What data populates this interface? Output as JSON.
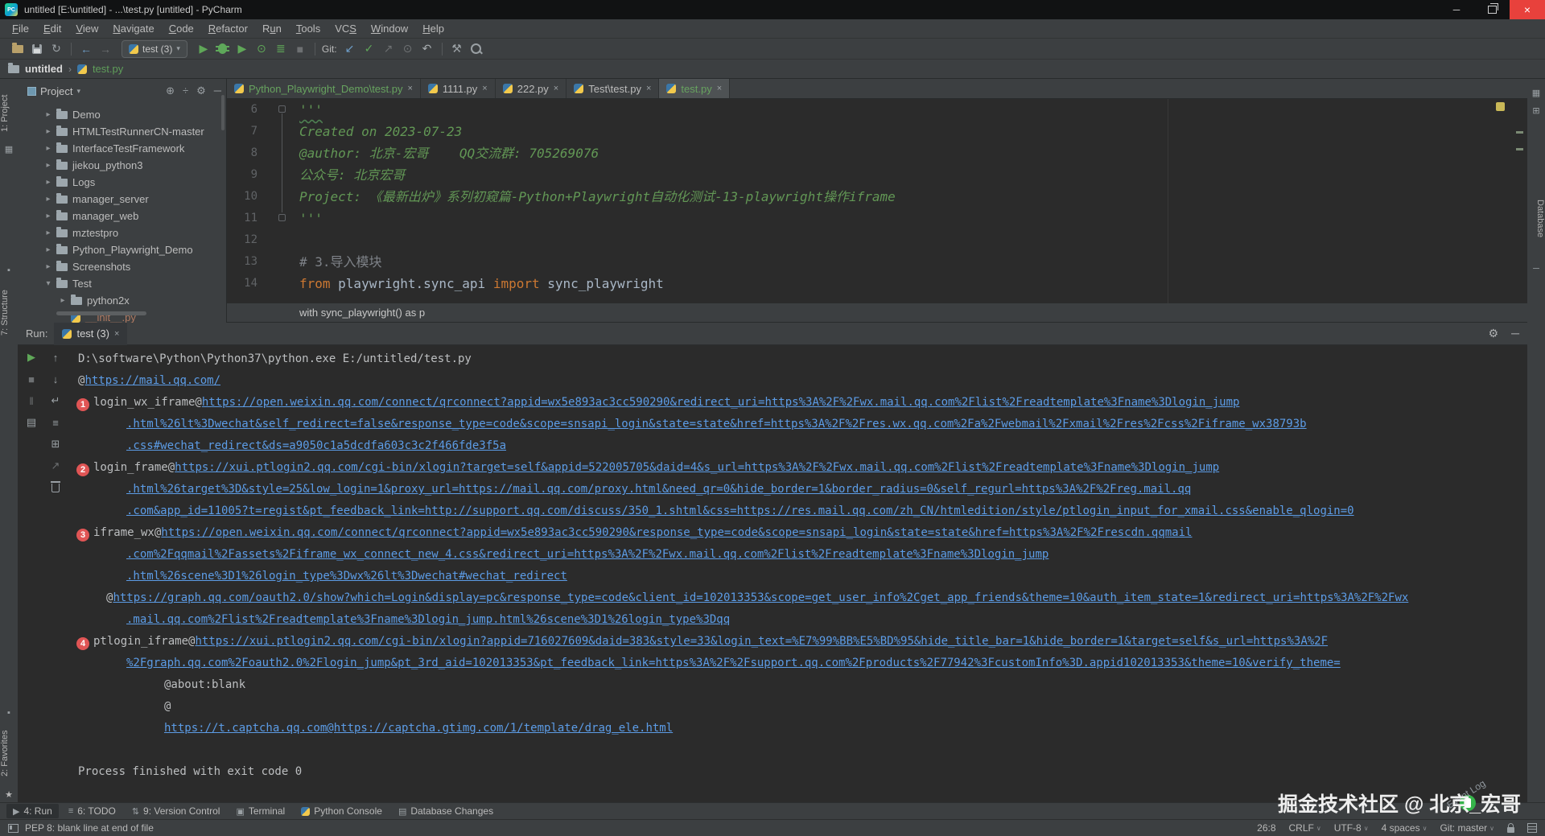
{
  "window": {
    "title": "untitled [E:\\untitled] - ...\\test.py [untitled] - PyCharm",
    "logo": "PC",
    "minimize": "─",
    "close": "×"
  },
  "menus": [
    {
      "label": "File",
      "m": 0
    },
    {
      "label": "Edit",
      "m": 0
    },
    {
      "label": "View",
      "m": 0
    },
    {
      "label": "Navigate",
      "m": 0
    },
    {
      "label": "Code",
      "m": 0
    },
    {
      "label": "Refactor",
      "m": 0
    },
    {
      "label": "Run",
      "m": 1
    },
    {
      "label": "Tools",
      "m": 0
    },
    {
      "label": "VCS",
      "m": 2
    },
    {
      "label": "Window",
      "m": 0
    },
    {
      "label": "Help",
      "m": 0
    }
  ],
  "toolbar": {
    "run_config": "test (3)",
    "git_label": "Git:",
    "icons": [
      {
        "name": "open-folder-icon",
        "kind": "folder"
      },
      {
        "name": "save-icon",
        "kind": "floppy"
      },
      {
        "name": "sync-icon",
        "glyph": "↻",
        "cls": "c-dim2"
      },
      {
        "sep": true
      },
      {
        "name": "back-icon",
        "glyph": "←",
        "cls": "c-blue"
      },
      {
        "name": "forward-icon",
        "glyph": "→",
        "cls": "c-dim"
      },
      {
        "runconfig": true
      },
      {
        "name": "run-icon",
        "glyph": "▶",
        "cls": "c-green"
      },
      {
        "name": "debug-icon",
        "kind": "bug"
      },
      {
        "name": "run-coverage-icon",
        "glyph": "▶",
        "cls": "c-green"
      },
      {
        "name": "profiler-icon",
        "glyph": "⊙",
        "cls": "c-green"
      },
      {
        "name": "run-concurrency-icon",
        "glyph": "≣",
        "cls": "c-green"
      },
      {
        "name": "stop-icon",
        "glyph": "■",
        "cls": "c-dim"
      },
      {
        "sep": true
      },
      {
        "gitlabel": true
      },
      {
        "name": "git-update-icon",
        "glyph": "↙",
        "cls": "c-blue"
      },
      {
        "name": "git-commit-icon",
        "glyph": "✓",
        "cls": "c-green"
      },
      {
        "name": "git-push-icon",
        "glyph": "↗",
        "cls": "c-dim"
      },
      {
        "name": "git-history-icon",
        "glyph": "⊙",
        "cls": "c-dim"
      },
      {
        "name": "git-rollback-icon",
        "glyph": "↶",
        "cls": "c-light"
      },
      {
        "sep": true
      },
      {
        "name": "wrench-icon",
        "glyph": "⚒",
        "cls": "c-dim2"
      },
      {
        "name": "search-icon",
        "kind": "search"
      }
    ]
  },
  "breadcrumb": {
    "project": "untitled",
    "separator": "›",
    "file": "test.py"
  },
  "left_stripe": {
    "project": "1: Project",
    "structure": "7: Structure",
    "favorites": "2: Favorites",
    "star": "★"
  },
  "right_stripe": {
    "database": "Database"
  },
  "project_panel": {
    "title": "Project",
    "dropdown": "▾",
    "header_icons": [
      {
        "name": "locate-icon",
        "glyph": "⊕"
      },
      {
        "name": "collapse-all-icon",
        "glyph": "÷"
      },
      {
        "name": "settings-icon",
        "glyph": "⚙"
      },
      {
        "name": "hide-icon",
        "glyph": "─"
      }
    ],
    "items": [
      {
        "arrow": "▸",
        "icon": "folder",
        "label": "Demo",
        "lvl": 0
      },
      {
        "arrow": "▸",
        "icon": "folder",
        "label": "HTMLTestRunnerCN-master",
        "lvl": 0
      },
      {
        "arrow": "▸",
        "icon": "folder",
        "label": "InterfaceTestFramework",
        "lvl": 0
      },
      {
        "arrow": "▸",
        "icon": "folder",
        "label": "jiekou_python3",
        "lvl": 0
      },
      {
        "arrow": "▸",
        "icon": "folder",
        "label": "Logs",
        "lvl": 0
      },
      {
        "arrow": "▸",
        "icon": "folder",
        "label": "manager_server",
        "lvl": 0
      },
      {
        "arrow": "▸",
        "icon": "folder",
        "label": "manager_web",
        "lvl": 0
      },
      {
        "arrow": "▸",
        "icon": "folder",
        "label": "mztestpro",
        "lvl": 0
      },
      {
        "arrow": "▸",
        "icon": "folder",
        "label": "Python_Playwright_Demo",
        "lvl": 0
      },
      {
        "arrow": "▸",
        "icon": "folder",
        "label": "Screenshots",
        "lvl": 0
      },
      {
        "arrow": "▾",
        "icon": "folder",
        "label": "Test",
        "lvl": 0
      },
      {
        "arrow": "▸",
        "icon": "folder",
        "label": "python2x",
        "lvl": 1
      },
      {
        "arrow": "",
        "icon": "python",
        "label": "__init__.py",
        "lvl": 1,
        "cls": "unversioned"
      }
    ]
  },
  "editor": {
    "tabs": [
      {
        "label": "Python_Playwright_Demo\\test.py",
        "cls": "green",
        "close": "×"
      },
      {
        "label": "1111.py",
        "cls": "",
        "close": "×"
      },
      {
        "label": "222.py",
        "cls": "",
        "close": "×"
      },
      {
        "label": "Test\\test.py",
        "cls": "",
        "close": "×"
      },
      {
        "label": "test.py",
        "cls": "green active",
        "close": "×"
      }
    ],
    "lines": [
      {
        "num": "6",
        "fold": true,
        "parts": [
          [
            "str wavy",
            "'''"
          ]
        ]
      },
      {
        "num": "7",
        "parts": [
          [
            "doc",
            "Created on 2023-07-23"
          ]
        ]
      },
      {
        "num": "8",
        "parts": [
          [
            "doc",
            "@author: 北京-宏哥    QQ交流群: 705269076"
          ]
        ]
      },
      {
        "num": "9",
        "parts": [
          [
            "doc",
            "公众号: 北京宏哥"
          ]
        ]
      },
      {
        "num": "10",
        "parts": [
          [
            "doc",
            "Project: 《最新出炉》系列初窥篇-Python+Playwright自动化测试-13-playwright操作iframe"
          ]
        ]
      },
      {
        "num": "11",
        "fold": true,
        "parts": [
          [
            "str",
            "'''"
          ]
        ]
      },
      {
        "num": "12",
        "parts": []
      },
      {
        "num": "13",
        "parts": [
          [
            "com",
            "# 3.导入模块"
          ]
        ]
      },
      {
        "num": "14",
        "parts": [
          [
            "kw",
            "from"
          ],
          [
            "pln",
            " playwright.sync_api "
          ],
          [
            "kw",
            "import"
          ],
          [
            "pln",
            " sync_playwright"
          ]
        ]
      }
    ],
    "sticky_line": "with sync_playwright() as p"
  },
  "run_panel": {
    "label": "Run:",
    "tab": "test (3)",
    "tab_close": "×",
    "header_icons": [
      {
        "name": "settings-icon",
        "glyph": "⚙"
      },
      {
        "name": "minimize-icon",
        "glyph": "─"
      }
    ],
    "toolbar_col1": [
      {
        "name": "rerun-icon",
        "glyph": "▶",
        "cls": "green"
      },
      {
        "name": "stop-icon",
        "glyph": "■",
        "cls": "dim"
      },
      {
        "name": "pause-icon",
        "glyph": "‖",
        "cls": "dim"
      },
      {
        "name": "restore-layout-icon",
        "glyph": "▤",
        "cls": ""
      }
    ],
    "toolbar_col2": [
      {
        "name": "up-stack-icon",
        "glyph": "↑",
        "cls": ""
      },
      {
        "name": "down-stack-icon",
        "glyph": "↓",
        "cls": ""
      },
      {
        "name": "soft-wrap-icon",
        "glyph": "↵",
        "cls": ""
      },
      {
        "name": "scroll-end-icon",
        "glyph": "≡",
        "cls": ""
      },
      {
        "name": "print-icon",
        "glyph": "⊞",
        "cls": ""
      },
      {
        "name": "export-icon",
        "glyph": "↗",
        "cls": "dim"
      },
      {
        "name": "clear-icon",
        "glyph": "",
        "cls": "trash"
      }
    ],
    "console": [
      {
        "cls": "l0",
        "text": "D:\\software\\Python\\Python37\\python.exe E:/untitled/test.py"
      },
      {
        "cls": "l0",
        "pre": "@",
        "link": "https://mail.qq.com/"
      },
      {
        "cls": "l1",
        "badge": "1",
        "pre": "login_wx_iframe@",
        "link": "https://open.weixin.qq.com/connect/qrconnect?appid=wx5e893ac3cc590290&redirect_uri=https%3A%2F%2Fwx.mail.qq.com%2Flist%2Freadtemplate%3Fname%3Dlogin_jump"
      },
      {
        "cls": "l2",
        "link": ".html%26lt%3Dwechat&self_redirect=false&response_type=code&scope=snsapi_login&state=state&href=https%3A%2F%2Fres.wx.qq.com%2Fa%2Fwebmail%2Fxmail%2Fres%2Fcss%2Fiframe_wx38793b"
      },
      {
        "cls": "l2",
        "link": ".css#wechat_redirect&ds=a9050c1a5dcdfa603c3c2f466fde3f5a"
      },
      {
        "cls": "l1",
        "badge": "2",
        "pre": "login_frame@",
        "link": "https://xui.ptlogin2.qq.com/cgi-bin/xlogin?target=self&appid=522005705&daid=4&s_url=https%3A%2F%2Fwx.mail.qq.com%2Flist%2Freadtemplate%3Fname%3Dlogin_jump"
      },
      {
        "cls": "l2",
        "link": ".html%26target%3D&style=25&low_login=1&proxy_url=https://mail.qq.com/proxy.html&need_qr=0&hide_border=1&border_radius=0&self_regurl=https%3A%2F%2Freg.mail.qq"
      },
      {
        "cls": "l2",
        "link": ".com&app_id=11005?t=regist&pt_feedback_link=http://support.qq.com/discuss/350_1.shtml&css=https://res.mail.qq.com/zh_CN/htmledition/style/ptlogin_input_for_xmail.css&enable_qlogin=0"
      },
      {
        "cls": "l1",
        "badge": "3",
        "pre": "iframe_wx@",
        "link": "https://open.weixin.qq.com/connect/qrconnect?appid=wx5e893ac3cc590290&response_type=code&scope=snsapi_login&state=state&href=https%3A%2F%2Frescdn.qqmail"
      },
      {
        "cls": "l2",
        "link": ".com%2Fqqmail%2Fassets%2Fiframe_wx_connect_new_4.css&redirect_uri=https%3A%2F%2Fwx.mail.qq.com%2Flist%2Freadtemplate%3Fname%3Dlogin_jump"
      },
      {
        "cls": "l2",
        "link": ".html%26scene%3D1%26login_type%3Dwx%26lt%3Dwechat#wechat_redirect"
      },
      {
        "cls": "l1b",
        "pre": "@",
        "link": "https://graph.qq.com/oauth2.0/show?which=Login&display=pc&response_type=code&client_id=102013353&scope=get_user_info%2Cget_app_friends&theme=10&auth_item_state=1&redirect_uri=https%3A%2F%2Fwx"
      },
      {
        "cls": "l2",
        "link": ".mail.qq.com%2Flist%2Freadtemplate%3Fname%3Dlogin_jump.html%26scene%3D1%26login_type%3Dqq"
      },
      {
        "cls": "l1",
        "badge": "4",
        "pre": "ptlogin_iframe@",
        "link": "https://xui.ptlogin2.qq.com/cgi-bin/xlogin?appid=716027609&daid=383&style=33&login_text=%E7%99%BB%E5%BD%95&hide_title_bar=1&hide_border=1&target=self&s_url=https%3A%2F"
      },
      {
        "cls": "l2",
        "link": "%2Fgraph.qq.com%2Foauth2.0%2Flogin_jump&pt_3rd_aid=102013353&pt_feedback_link=https%3A%2F%2Fsupport.qq.com%2Fproducts%2F77942%3FcustomInfo%3D.appid102013353&theme=10&verify_theme="
      },
      {
        "cls": "l3",
        "text": "@about:blank"
      },
      {
        "cls": "l3",
        "text": "@"
      },
      {
        "cls": "l3",
        "link": "https://t.captcha.qq.com@https://captcha.gtimg.com/1/template/drag_ele.html"
      },
      {
        "cls": "l0",
        "text": ""
      },
      {
        "cls": "l0",
        "text": "Process finished with exit code 0"
      }
    ]
  },
  "bottom_bar": [
    {
      "label": "4: Run",
      "icon": "▶",
      "name": "toolwindow-run",
      "active": true
    },
    {
      "label": "6: TODO",
      "icon": "≡",
      "name": "toolwindow-todo"
    },
    {
      "label": "9: Version Control",
      "icon": "⇅",
      "name": "toolwindow-version-control"
    },
    {
      "label": "Terminal",
      "icon": "▣",
      "name": "toolwindow-terminal"
    },
    {
      "label": "Python Console",
      "icon": "py",
      "name": "toolwindow-python-console"
    },
    {
      "label": "Database Changes",
      "icon": "▤",
      "name": "toolwindow-database-changes"
    }
  ],
  "status_bar": {
    "left": "PEP 8: blank line at end of file",
    "right": [
      "26:8",
      "CRLF",
      "UTF-8",
      "4 spaces",
      "Git: master"
    ]
  },
  "watermark": {
    "text": "掘金技术社区 @ 北京_宏哥",
    "event_log": "Event Log"
  }
}
